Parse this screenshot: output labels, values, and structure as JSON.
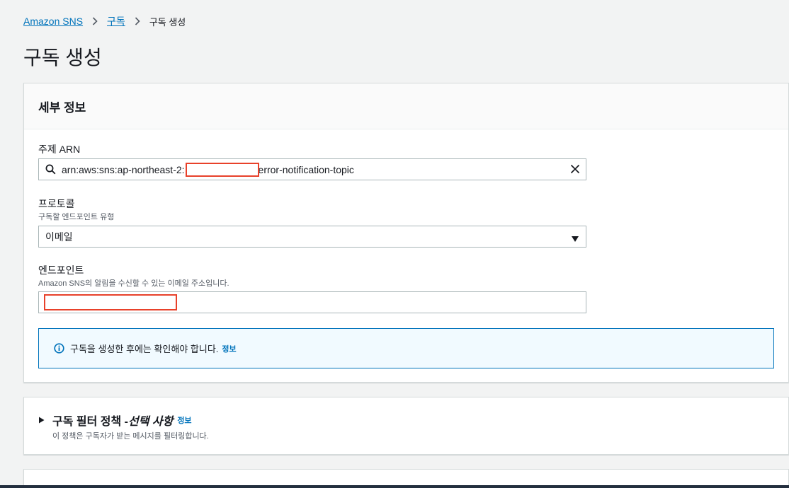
{
  "breadcrumb": {
    "items": [
      {
        "label": "Amazon SNS"
      },
      {
        "label": "구독"
      }
    ],
    "current": "구독 생성"
  },
  "page": {
    "title": "구독 생성"
  },
  "details": {
    "title": "세부 정보",
    "topic_arn": {
      "label": "주제 ARN",
      "value_prefix": "arn:aws:sns:ap-northeast-2:",
      "value_suffix": "error-notification-topic"
    },
    "protocol": {
      "label": "프로토콜",
      "description": "구독할 엔드포인트 유형",
      "selected": "이메일"
    },
    "endpoint": {
      "label": "엔드포인트",
      "description": "Amazon SNS의 알림을 수신할 수 있는 이메일 주소입니다.",
      "value": ""
    },
    "info_alert": {
      "text": "구독을 생성한 후에는 확인해야 합니다.",
      "link": "정보"
    }
  },
  "filter_policy": {
    "title": "구독 필터 정책 - ",
    "optional": "선택 사항",
    "info_link": "정보",
    "description": "이 정책은 구독자가 받는 메시지를 필터링합니다."
  },
  "colors": {
    "link": "#0073bb",
    "redaction": "#e8412a",
    "info_bg": "#f1faff"
  }
}
